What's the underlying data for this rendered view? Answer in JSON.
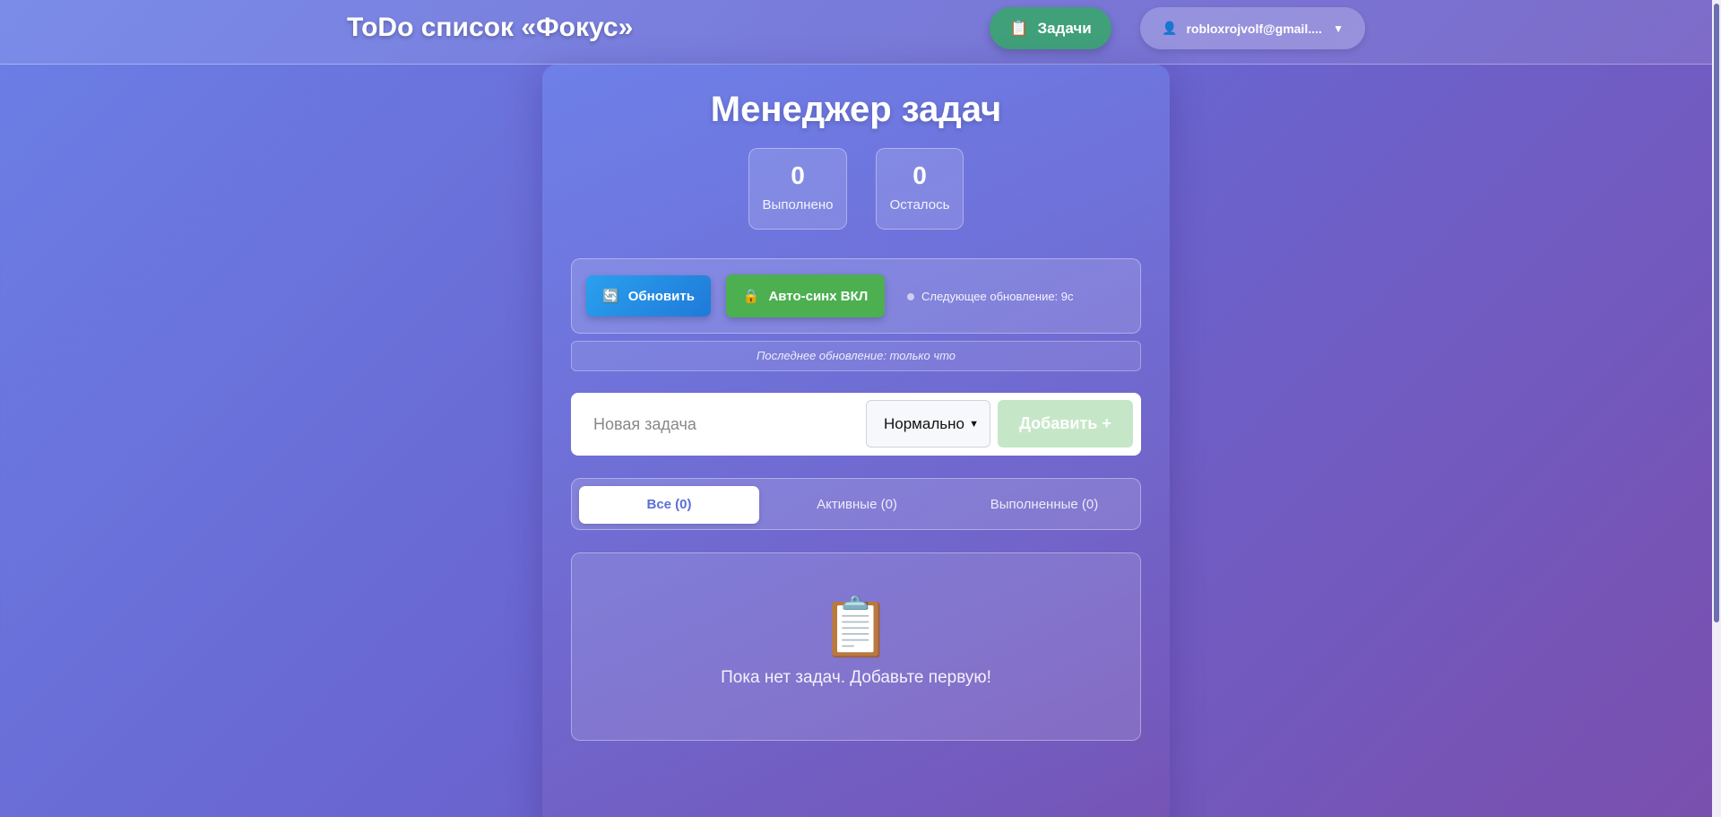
{
  "header": {
    "app_title": "ToDo список «Фокус»",
    "nav_tasks_icon": "clipboard-icon",
    "nav_tasks_label": "Задачи",
    "user_email": "robloxrojvolf@gmail....",
    "user_icon": "user-icon"
  },
  "main": {
    "title": "Менеджер задач",
    "stats": {
      "done_count": "0",
      "done_label": "Выполнено",
      "left_count": "0",
      "left_label": "Осталось"
    },
    "sync": {
      "refresh_label": "Обновить",
      "auto_sync_label": "Авто-синх ВКЛ",
      "next_update": "Следующее обновление: 9с",
      "last_update": "Последнее обновление: только что"
    },
    "add_form": {
      "placeholder": "Новая задача",
      "priority_selected": "Нормально",
      "add_label": "Добавить +"
    },
    "filters": {
      "all": "Все (0)",
      "active": "Активные (0)",
      "done": "Выполненные (0)"
    },
    "empty": {
      "message": "Пока нет задач. Добавьте первую!"
    }
  },
  "colors": {
    "accent_green": "#3fa07a",
    "refresh_blue": "#1f7ad8",
    "auto_sync_green": "#4caf50",
    "active_tab_text": "#5a6fd8"
  }
}
